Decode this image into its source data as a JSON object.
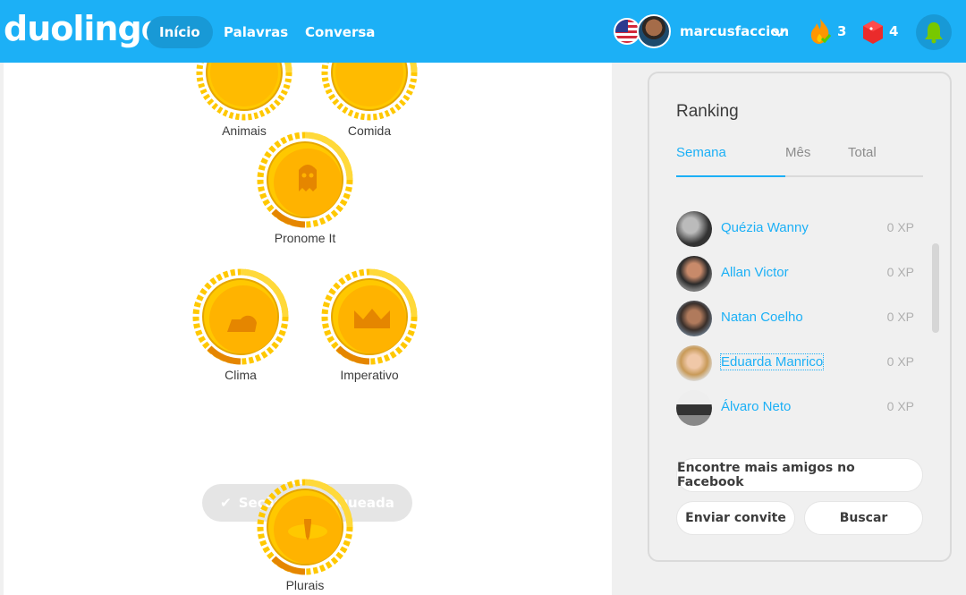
{
  "header": {
    "logo": "duolingo",
    "nav": [
      "Início",
      "Palavras",
      "Conversa"
    ],
    "username": "marcusfaccion",
    "streak_count": "3",
    "gems_count": "4",
    "colors": {
      "bar": "#1cb0f6",
      "active_nav": "#1899d6"
    }
  },
  "skills": [
    {
      "label": "Animais"
    },
    {
      "label": "Comida"
    },
    {
      "label": "Pronome It"
    },
    {
      "label": "Clima"
    },
    {
      "label": "Imperativo"
    },
    {
      "label": "Plurais"
    }
  ],
  "section": {
    "unlocked_label": "Seção desbloqueada"
  },
  "ranking": {
    "title": "Ranking",
    "tabs": [
      "Semana",
      "Mês",
      "Total"
    ],
    "friends": [
      {
        "name": "Quézia Wanny",
        "xp": "0 XP"
      },
      {
        "name": "Allan Victor",
        "xp": "0 XP"
      },
      {
        "name": "Natan Coelho",
        "xp": "0 XP"
      },
      {
        "name": "Eduarda Manrico",
        "xp": "0 XP"
      },
      {
        "name": "Álvaro Neto",
        "xp": "0 XP"
      }
    ],
    "buttons": {
      "facebook": "Encontre mais amigos no Facebook",
      "invite": "Enviar convite",
      "search": "Buscar"
    }
  }
}
